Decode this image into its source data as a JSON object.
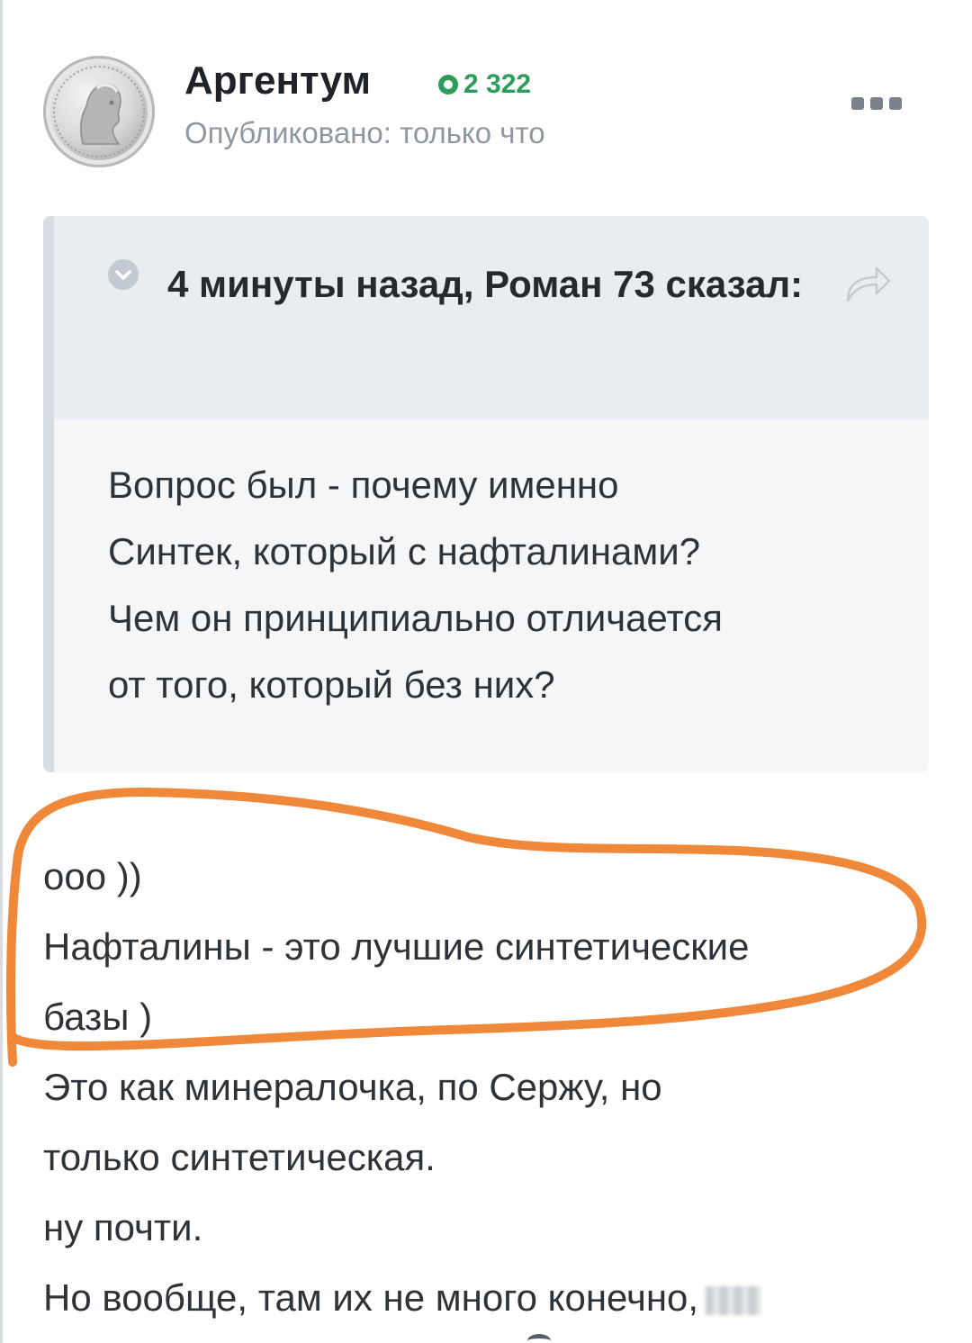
{
  "post": {
    "author": {
      "name": "Аргентум",
      "reputation": "2 322",
      "published": "Опубликовано: только что",
      "avatar_icon": "silver-coin-portrait-icon"
    },
    "more_icon": "ellipsis-menu-icon",
    "quote": {
      "citation": "4 минуты назад, Роман 73 сказал:",
      "toggle_icon": "chevron-down-icon",
      "share_icon": "share-arrow-icon",
      "lines": [
        "Вопрос был - почему именно",
        "Синтек, который с нафталинами?",
        "Чем он принципиально отличается",
        "от того, который без них?"
      ]
    },
    "reply_lines": [
      "ооо ))",
      "Нафталины - это лучшие синтетические",
      "базы )",
      "Это как минералочка, по Сержу, но",
      "только синтетическая.",
      "ну почти.",
      "Но вообще, там их не много конечно,"
    ]
  },
  "colors": {
    "reputation_green": "#2e9c5a",
    "highlight_orange": "#f0883a",
    "quote_background": "#f4f6f8",
    "quote_header_background": "#e9edf1",
    "meta_gray": "#8f98a1"
  }
}
